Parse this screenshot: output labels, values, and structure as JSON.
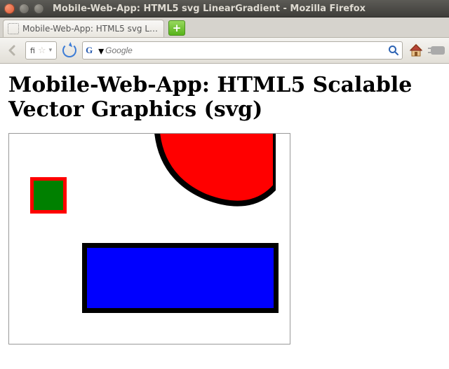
{
  "window": {
    "title": "Mobile-Web-App: HTML5 svg LinearGradient - Mozilla Firefox"
  },
  "tabstrip": {
    "active_tab_label": "Mobile-Web-App: HTML5 svg L…",
    "newtab_glyph": "+"
  },
  "navbar": {
    "url_prefix": "fi",
    "star_glyph": "☆",
    "dropdown_glyph": "▾",
    "search_placeholder": "Google"
  },
  "page": {
    "heading": "Mobile-Web-App: HTML5 Scalable Vector Graphics (svg)"
  },
  "svg": {
    "shapes": {
      "green_square": {
        "fill": "#008000",
        "stroke": "red"
      },
      "blue_rect": {
        "fill": "#0000ff",
        "stroke": "#000"
      },
      "red_blob": {
        "fill": "red",
        "stroke": "#000"
      }
    }
  }
}
